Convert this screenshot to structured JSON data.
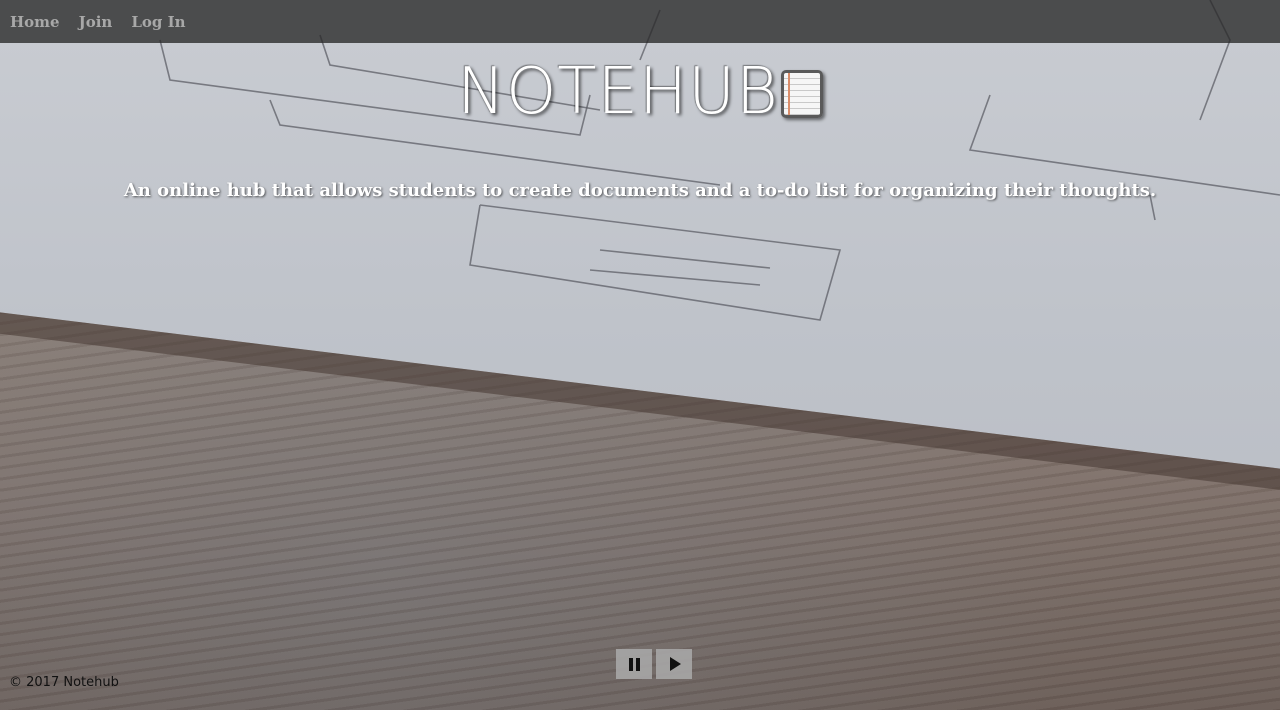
{
  "nav": {
    "home": "Home",
    "join": "Join",
    "login": "Log In"
  },
  "brand": {
    "title": "NOTEHUB",
    "icon": "notebook-icon"
  },
  "hero": {
    "tagline": "An online hub that allows students to create documents and a to-do list for organizing their thoughts."
  },
  "video_controls": {
    "pause_icon": "pause-icon",
    "play_icon": "play-icon"
  },
  "footer": {
    "copyright": "© 2017 Notehub"
  },
  "colors": {
    "navbar_bg": "#282828",
    "nav_text": "#a8a8a8",
    "brand_text": "#ffffff",
    "control_bg": "#aaaaaa"
  }
}
